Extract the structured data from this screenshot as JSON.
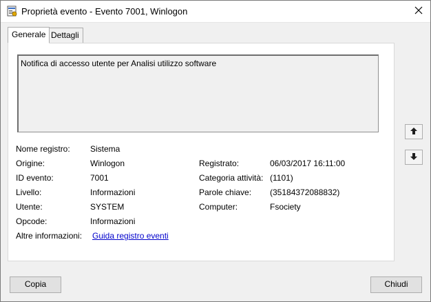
{
  "window": {
    "title": "Proprietà evento - Evento 7001, Winlogon",
    "app_icon": "event-log-icon",
    "close_icon": "close-icon"
  },
  "tabs": [
    {
      "label": "Generale",
      "active": true
    },
    {
      "label": "Dettagli",
      "active": false
    }
  ],
  "description": "Notifica di accesso utente per Analisi utilizzo software",
  "fields": {
    "log_name": {
      "label": "Nome registro:",
      "value": "Sistema"
    },
    "source": {
      "label": "Origine:",
      "value": "Winlogon"
    },
    "event_id": {
      "label": "ID evento:",
      "value": "7001"
    },
    "level": {
      "label": "Livello:",
      "value": "Informazioni"
    },
    "user": {
      "label": "Utente:",
      "value": "SYSTEM"
    },
    "opcode": {
      "label": "Opcode:",
      "value": "Informazioni"
    },
    "more_info": {
      "label": "Altre informazioni:",
      "value": "Guida registro eventi"
    },
    "logged": {
      "label": "Registrato:",
      "value": "06/03/2017 16:11:00"
    },
    "task_category": {
      "label": "Categoria attività:",
      "value": "(1101)"
    },
    "keywords": {
      "label": "Parole chiave:",
      "value": "(35184372088832)"
    },
    "computer": {
      "label": "Computer:",
      "value": "Fsociety"
    }
  },
  "nav": {
    "up_icon": "arrow-up-icon",
    "down_icon": "arrow-down-icon"
  },
  "buttons": {
    "copy": "Copia",
    "close": "Chiudi"
  }
}
